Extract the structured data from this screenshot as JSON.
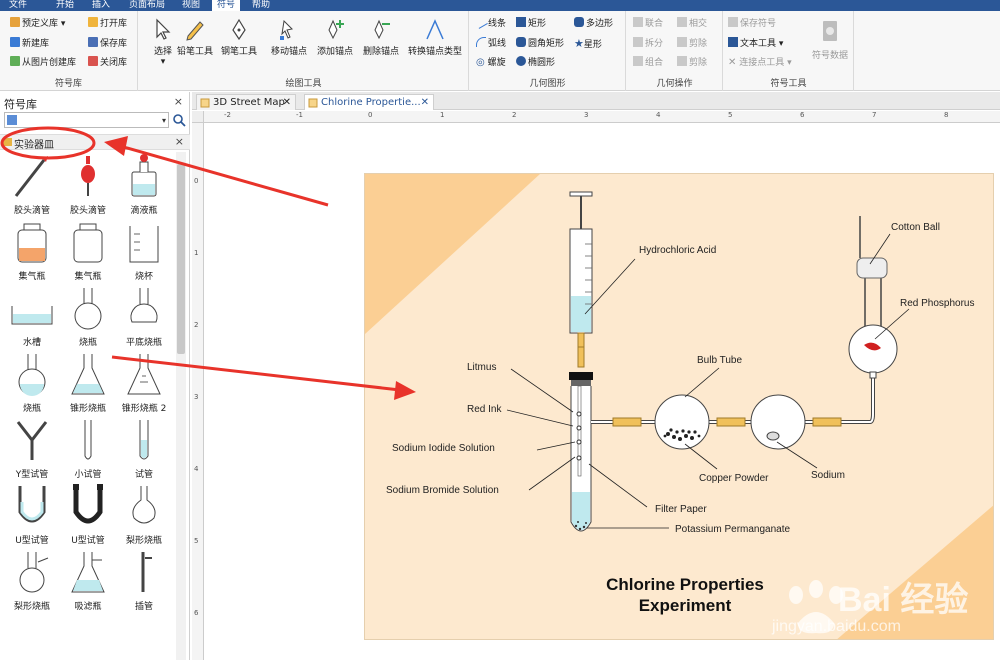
{
  "menu": {
    "items": [
      "文件",
      "开始",
      "插入",
      "页面布局",
      "视图",
      "符号",
      "帮助"
    ],
    "active_index": 5
  },
  "ribbon": {
    "symbol_library": {
      "label": "符号库",
      "predefined": "预定义库",
      "new_lib": "新建库",
      "from_image": "从图片创建库",
      "open_lib": "打开库",
      "save_lib": "保存库",
      "close_lib": "关闭库"
    },
    "draw_tools": {
      "label": "绘图工具",
      "select": "选择",
      "pencil": "铅笔工具",
      "pen": "钢笔工具",
      "move_anchor": "移动锚点",
      "add_anchor": "添加锚点",
      "delete_anchor": "删除锚点",
      "convert_anchor": "转换锚点类型"
    },
    "geometry": {
      "label": "几何图形",
      "line": "线条",
      "rect": "矩形",
      "polygon": "多边形",
      "arc": "弧线",
      "round_rect": "圆角矩形",
      "star": "星形",
      "spiral": "螺旋",
      "ellipse": "椭圆形"
    },
    "geo_ops": {
      "label": "几何操作",
      "union": "联合",
      "intersect": "相交",
      "split": "拆分",
      "subtract": "剪除",
      "combine": "组合",
      "cut": "剪除"
    },
    "symbol_tools": {
      "label": "符号工具",
      "save_symbol": "保存符号",
      "text_tool": "文本工具",
      "connect_tool": "连接点工具",
      "symbol_data": "符号数据"
    }
  },
  "panel": {
    "title": "符号库",
    "close": "×",
    "category": "实验器皿",
    "shapes": [
      {
        "label": "胶头滴管",
        "icon": "dropper-icon"
      },
      {
        "label": "胶头滴管",
        "icon": "bulb-dropper-icon"
      },
      {
        "label": "滴液瓶",
        "icon": "dropping-bottle-icon"
      },
      {
        "label": "集气瓶",
        "icon": "gas-jar-red-icon"
      },
      {
        "label": "集气瓶",
        "icon": "gas-jar-icon"
      },
      {
        "label": "烧杯",
        "icon": "beaker-icon"
      },
      {
        "label": "水槽",
        "icon": "water-trough-icon"
      },
      {
        "label": "烧瓶",
        "icon": "round-flask-icon"
      },
      {
        "label": "平底烧瓶",
        "icon": "flat-flask-icon"
      },
      {
        "label": "烧瓶",
        "icon": "round-flask-water-icon"
      },
      {
        "label": "锥形烧瓶",
        "icon": "erlenmeyer-icon"
      },
      {
        "label": "锥形烧瓶 2",
        "icon": "erlenmeyer-2-icon"
      },
      {
        "label": "Y型试管",
        "icon": "y-tube-icon"
      },
      {
        "label": "小试管",
        "icon": "small-tube-icon"
      },
      {
        "label": "试管",
        "icon": "test-tube-icon"
      },
      {
        "label": "U型试管",
        "icon": "u-tube-icon"
      },
      {
        "label": "U型试管",
        "icon": "u-tube-black-icon"
      },
      {
        "label": "梨形烧瓶",
        "icon": "pear-flask-icon"
      },
      {
        "label": "梨形烧瓶",
        "icon": "pear-flask-2-icon"
      },
      {
        "label": "吸滤瓶",
        "icon": "filter-flask-icon"
      },
      {
        "label": "插管",
        "icon": "cannula-icon"
      }
    ]
  },
  "tabs": [
    {
      "label": "3D Street Map",
      "active": false
    },
    {
      "label": "Chlorine Propertie...",
      "active": true
    }
  ],
  "ruler": {
    "h_marks": [
      "-2",
      "-1",
      "0",
      "1",
      "2",
      "3",
      "4",
      "5",
      "6",
      "7",
      "8"
    ],
    "v_marks": [
      "0",
      "1",
      "2",
      "3",
      "4",
      "5",
      "6"
    ]
  },
  "diagram": {
    "title_line1": "Chlorine Properties",
    "title_line2": "Experiment",
    "labels": {
      "hcl": "Hydrochloric Acid",
      "cotton": "Cotton Ball",
      "red_phos": "Red Phosphorus",
      "litmus": "Litmus",
      "bulb": "Bulb Tube",
      "red_ink": "Red Ink",
      "nai": "Sodium Iodide Solution",
      "copper": "Copper Powder",
      "sodium": "Sodium",
      "nabr": "Sodium Bromide Solution",
      "filter": "Filter Paper",
      "kmno4": "Potassium Permanganate"
    }
  },
  "watermark": {
    "brand": "Bai 经验",
    "url": "jingyan.baidu.com"
  },
  "colors": {
    "menu_bg": "#2b5797",
    "page_bg": "#fde9cf",
    "accent_orange": "#f9c98a",
    "liquid": "#bfe9ee",
    "arrow_red": "#e8332a",
    "tube_yellow": "#f0c05a"
  }
}
